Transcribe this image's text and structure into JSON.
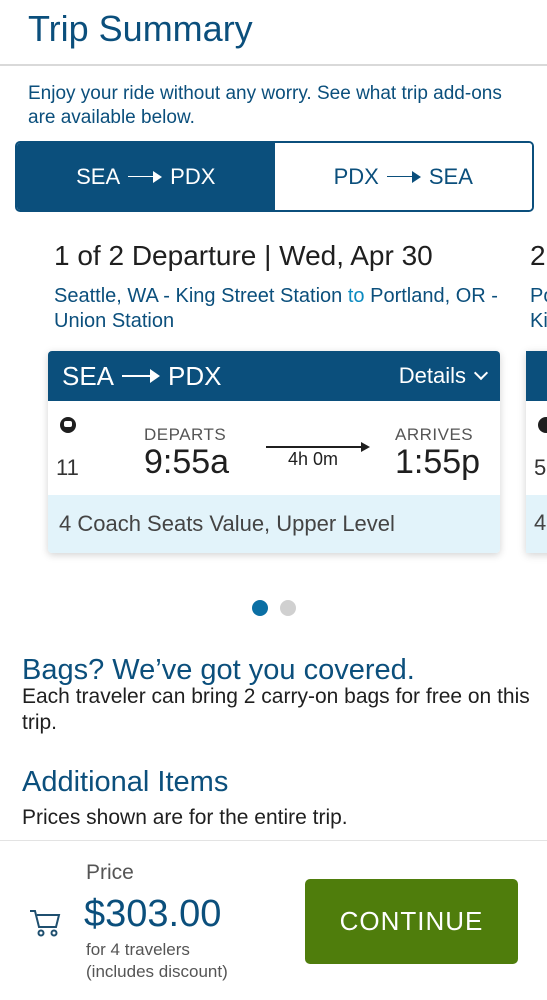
{
  "header": {
    "title": "Trip Summary"
  },
  "intro": "Enjoy your ride without any worry. See what trip add-ons are available below.",
  "direction_tabs": [
    {
      "from": "SEA",
      "to": "PDX",
      "active": true
    },
    {
      "from": "PDX",
      "to": "SEA",
      "active": false
    }
  ],
  "trips": [
    {
      "heading": "1 of 2 Departure | Wed, Apr 30",
      "origin": "Seattle, WA - King Street Station",
      "connector": "to",
      "destination": "Portland, OR - Union Station",
      "card": {
        "from": "SEA",
        "to": "PDX",
        "details_label": "Details",
        "train_number": "11",
        "departs_label": "DEPARTS",
        "departs_time": "9:55a",
        "duration": "4h 0m",
        "arrives_label": "ARRIVES",
        "arrives_time": "1:55p",
        "seating": "4 Coach Seats Value, Upper Level"
      }
    }
  ],
  "peek": {
    "heading_start": "2",
    "route_line1": "Po",
    "route_line2": "Ki",
    "train_number_start": "5",
    "seating_start": "4"
  },
  "carousel": {
    "pages": 2,
    "current": 1
  },
  "bags": {
    "title": "Bags? We’ve got you covered.",
    "text": "Each traveler can bring 2 carry-on bags for free on this trip."
  },
  "additional_items": {
    "title": "Additional Items",
    "text": "Prices shown are for the entire trip."
  },
  "footer": {
    "cart_icon": "cart-icon",
    "price_label": "Price",
    "price_value": "$303.00",
    "price_note_line1": "for 4 travelers",
    "price_note_line2": "(includes discount)",
    "continue_label": "CONTINUE"
  },
  "colors": {
    "primary": "#0b4f7c",
    "accent_light": "#e2f3fa",
    "continue": "#4f7d0c"
  }
}
